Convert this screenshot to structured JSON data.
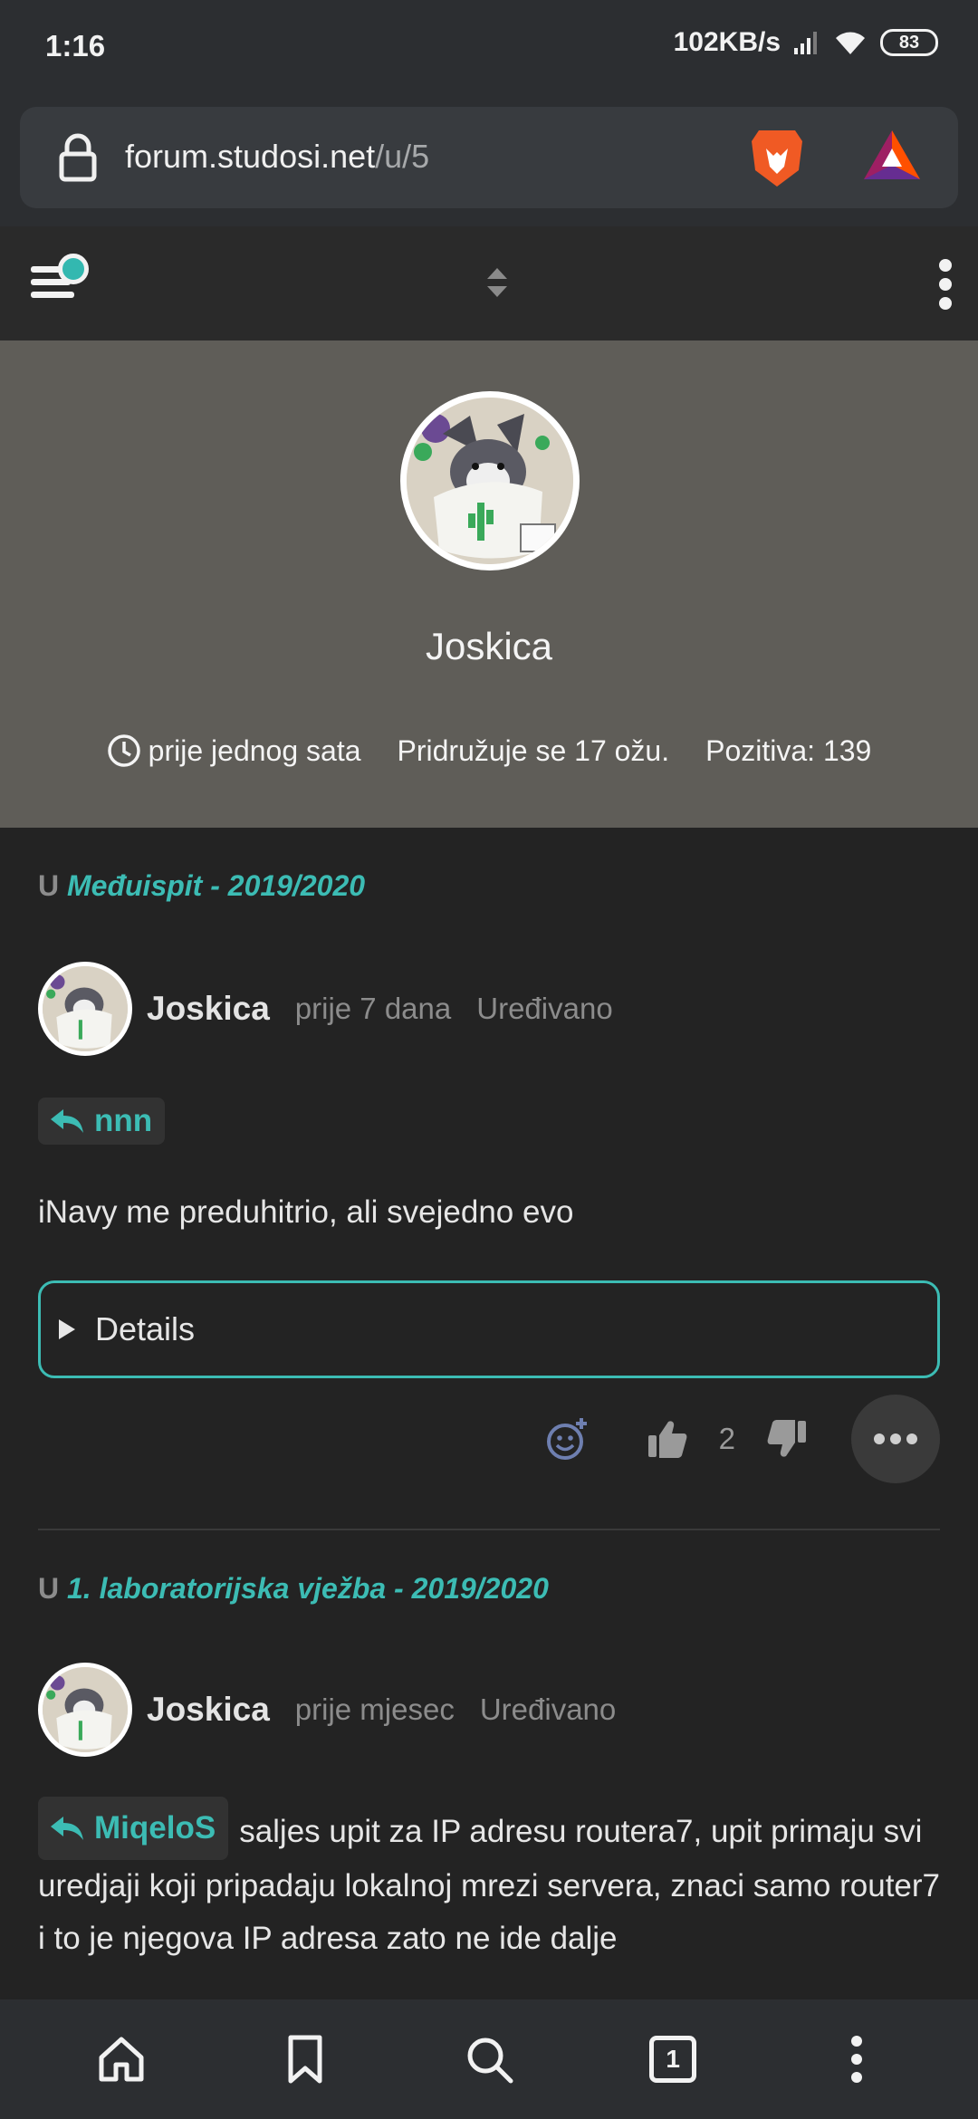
{
  "status_bar": {
    "time": "1:16",
    "network_speed": "102KB/s",
    "battery": "83"
  },
  "browser": {
    "url_domain": "forum.studosi.net",
    "url_path": "/u/5",
    "tab_count": "1"
  },
  "forum_header": {
    "menu_icon": "hamburger-menu-icon",
    "notification_color": "#33b8b0"
  },
  "profile": {
    "username": "Joskica",
    "last_seen": "prije jednog sata",
    "joined": "Pridružuje se 17 ožu.",
    "reputation": "Pozitiva: 139"
  },
  "posts": [
    {
      "category_prefix": "U",
      "category": "Međuispit - 2019/2020",
      "author": "Joskica",
      "time": "prije 7 dana",
      "edited": "Uređivano",
      "reply_to": "nnn",
      "body": "iNavy me preduhitrio, ali svejedno evo",
      "details_label": "Details",
      "votes": "2"
    },
    {
      "category_prefix": "U",
      "category": "1. laboratorijska vježba - 2019/2020",
      "author": "Joskica",
      "time": "prije mjesec",
      "edited": "Uređivano",
      "reply_to": "MiqeloS",
      "body": "saljes upit za IP adresu routera7, upit primaju svi uredjaji koji pripadaju lokalnoj mrezi servera, znaci samo router7 i to je njegova IP adresa zato ne ide dalje"
    }
  ],
  "colors": {
    "accent": "#3cbcb4",
    "background": "#232323",
    "cover": "#5f5d58"
  }
}
